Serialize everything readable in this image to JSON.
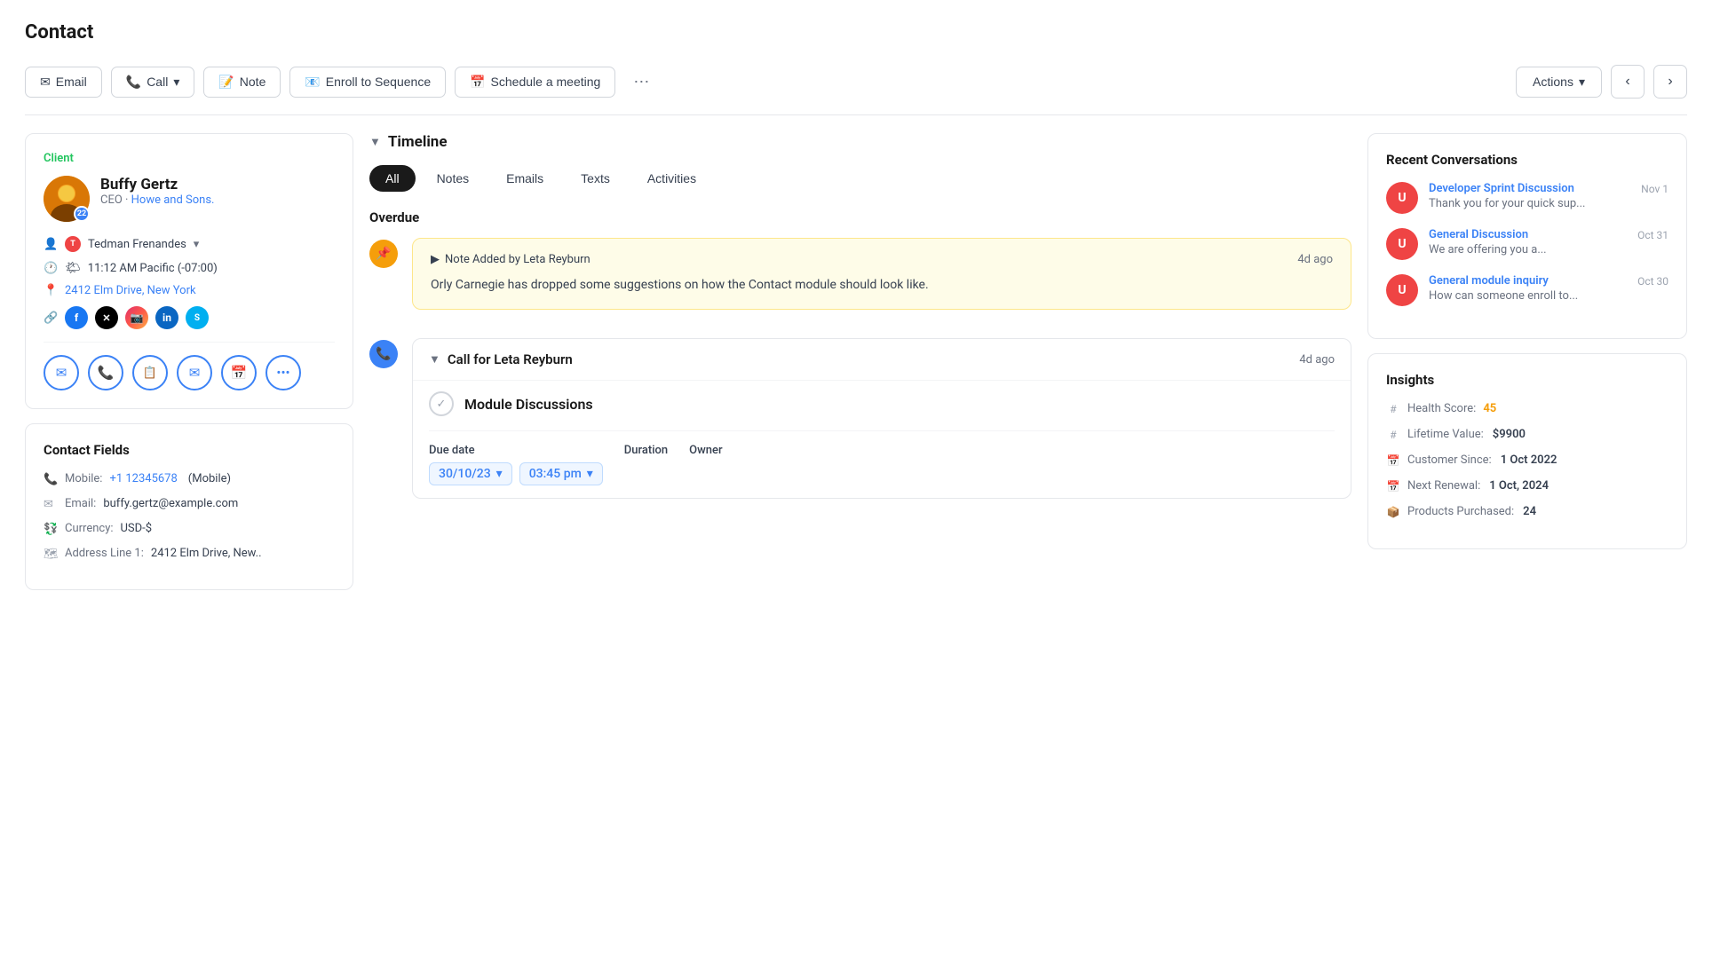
{
  "page": {
    "title": "Contact"
  },
  "toolbar": {
    "email_label": "Email",
    "call_label": "Call",
    "note_label": "Note",
    "enroll_label": "Enroll to Sequence",
    "schedule_label": "Schedule a meeting",
    "actions_label": "Actions"
  },
  "contact": {
    "client_label": "Client",
    "name": "Buffy Gertz",
    "role": "CEO",
    "company": "Howe and Sons.",
    "owner_name": "Tedman Frenandes",
    "time": "11:12 AM Pacific (-07:00)",
    "address": "2412 Elm Drive, New York",
    "badge_count": "22"
  },
  "contact_fields": {
    "title": "Contact Fields",
    "mobile_label": "Mobile:",
    "mobile_value": "+1 12345678",
    "mobile_suffix": "(Mobile)",
    "email_label": "Email:",
    "email_value": "buffy.gertz@example.com",
    "currency_label": "Currency:",
    "currency_value": "USD-$",
    "address_label": "Address Line 1:",
    "address_value": "2412 Elm Drive, New.."
  },
  "timeline": {
    "title": "Timeline",
    "tabs": [
      "All",
      "Notes",
      "Emails",
      "Texts",
      "Activities"
    ],
    "active_tab": "All",
    "overdue_label": "Overdue"
  },
  "note": {
    "header": "Note Added by Leta Reyburn",
    "time": "4d ago",
    "text": "Orly Carnegie has dropped some suggestions on how the Contact module should look like."
  },
  "call": {
    "title": "Call for Leta Reyburn",
    "time": "4d ago",
    "subject": "Module Discussions",
    "due_date_label": "Due date",
    "date_value": "30/10/23",
    "time_value": "03:45 pm",
    "duration_label": "Duration",
    "owner_label": "Owner"
  },
  "recent_conversations": {
    "title": "Recent Conversations",
    "items": [
      {
        "avatar_letter": "U",
        "title": "Developer Sprint Discussion",
        "date": "Nov 1",
        "preview": "Thank you for your quick sup..."
      },
      {
        "avatar_letter": "U",
        "title": "General Discussion",
        "date": "Oct 31",
        "preview": "We are offering you a..."
      },
      {
        "avatar_letter": "U",
        "title": "General module inquiry",
        "date": "Oct 30",
        "preview": "How can someone enroll to..."
      }
    ]
  },
  "insights": {
    "title": "Insights",
    "health_score_label": "Health Score:",
    "health_score_value": "45",
    "lifetime_value_label": "Lifetime Value:",
    "lifetime_value_value": "$9900",
    "customer_since_label": "Customer Since:",
    "customer_since_value": "1 Oct 2022",
    "next_renewal_label": "Next Renewal:",
    "next_renewal_value": "1 Oct, 2024",
    "products_purchased_label": "Products Purchased:",
    "products_purchased_value": "24"
  }
}
